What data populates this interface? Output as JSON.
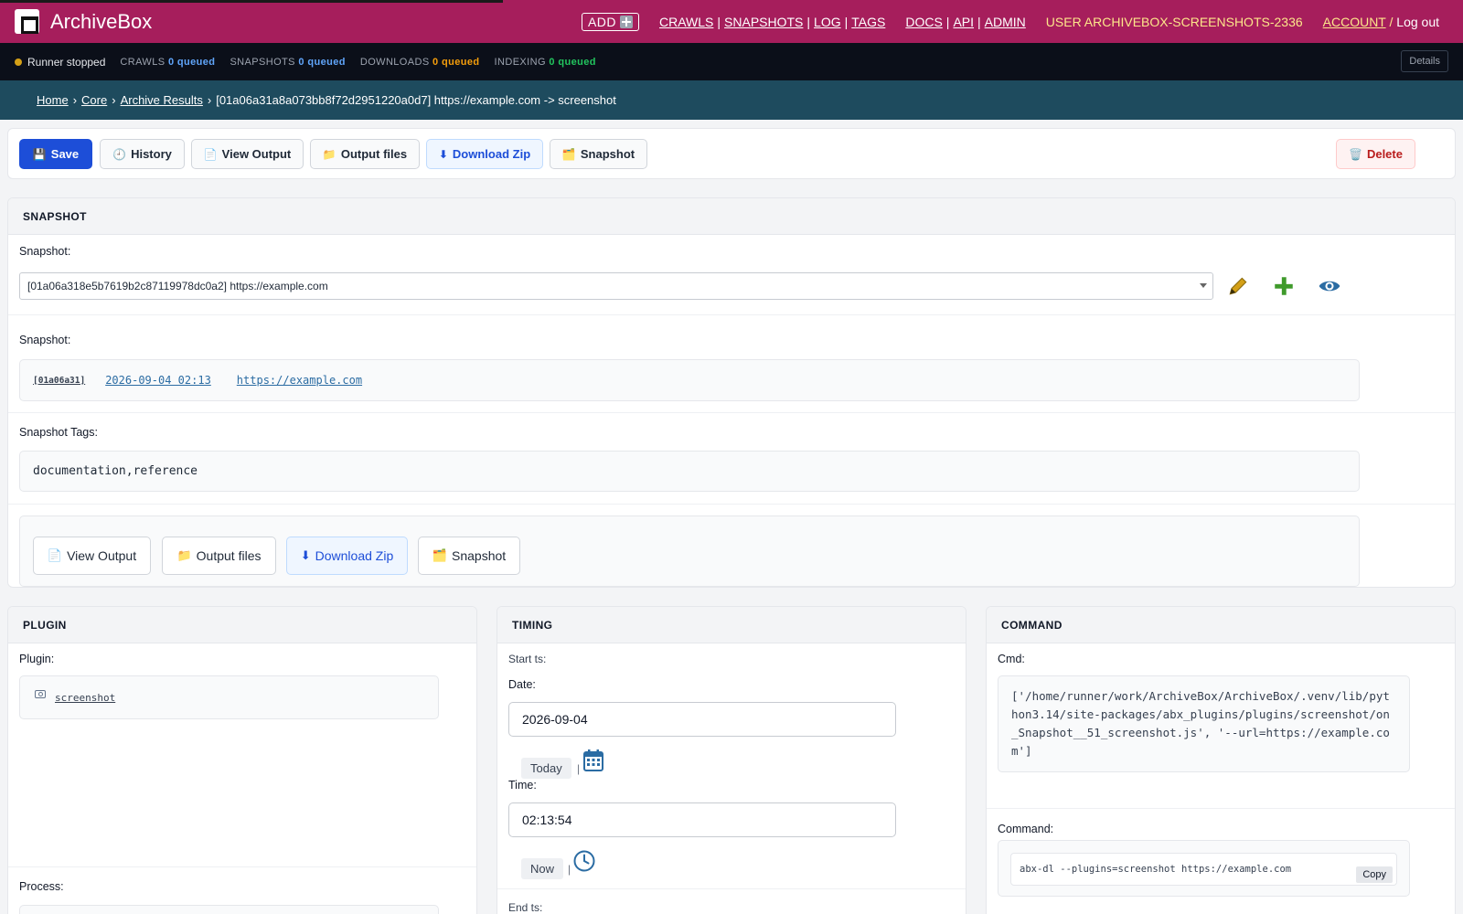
{
  "header": {
    "brand": "ArchiveBox",
    "add_label": "ADD",
    "nav_main": [
      "CRAWLS",
      "SNAPSHOTS",
      "LOG",
      "TAGS"
    ],
    "nav_docs": [
      "DOCS",
      "API",
      "ADMIN"
    ],
    "user_label": "USER ARCHIVEBOX-SCREENSHOTS-2336",
    "account": "ACCOUNT",
    "account_sep": "/",
    "logout": "Log out"
  },
  "status": {
    "runner": "Runner stopped",
    "crawls_label": "CRAWLS",
    "crawls_value": "0 queued",
    "snapshots_label": "SNAPSHOTS",
    "snapshots_value": "0 queued",
    "downloads_label": "DOWNLOADS",
    "downloads_value": "0 queued",
    "indexing_label": "INDEXING",
    "indexing_value": "0 queued",
    "details": "Details"
  },
  "breadcrumb": {
    "home": "Home",
    "core": "Core",
    "archive_results": "Archive Results",
    "current": "[01a06a31a8a073bb8f72d2951220a0d7] https://example.com -> screenshot",
    "sep": "›"
  },
  "toolbar": {
    "save": "Save",
    "history": "History",
    "view_output": "View Output",
    "output_files": "Output files",
    "download_zip": "Download Zip",
    "snapshot": "Snapshot",
    "delete": "Delete"
  },
  "snapshot_section": {
    "title": "SNAPSHOT",
    "select_label": "Snapshot:",
    "select_value": "[01a06a318e5b7619b2c87119978dc0a2] https://example.com",
    "readonly_label": "Snapshot:",
    "readonly_id": "[01a06a31]",
    "readonly_date": "2026-09-04 02:13",
    "readonly_url": "https://example.com",
    "tags_label": "Snapshot Tags:",
    "tags_value": "documentation,reference",
    "inner_view_output": "View Output",
    "inner_output_files": "Output files",
    "inner_download_zip": "Download Zip",
    "inner_snapshot": "Snapshot"
  },
  "plugin_section": {
    "title": "PLUGIN",
    "plugin_label": "Plugin:",
    "plugin_value": "screenshot",
    "process_label": "Process:"
  },
  "timing_section": {
    "title": "TIMING",
    "start_label": "Start ts:",
    "date_label": "Date:",
    "date_value": "2026-09-04",
    "today": "Today",
    "time_label": "Time:",
    "time_value": "02:13:54",
    "now": "Now",
    "sep": "|",
    "end_label": "End ts:"
  },
  "command_section": {
    "title": "COMMAND",
    "cmd_label": "Cmd:",
    "cmd_value": "['/home/runner/work/ArchiveBox/ArchiveBox/.venv/lib/python3.14/site-packages/abx_plugins/plugins/screenshot/on_Snapshot__51_screenshot.js', '--url=https://example.com']",
    "command_label": "Command:",
    "command_value": "abx-dl --plugins=screenshot https://example.com",
    "copy": "Copy"
  },
  "icons": {
    "save": "floppy-disk-icon",
    "history": "clock-icon",
    "view_output": "page-icon",
    "output_files": "folder-icon",
    "download_zip": "down-arrow-icon",
    "snapshot": "card-index-icon",
    "delete": "wastebasket-icon",
    "edit": "pencil-icon",
    "add": "plus-icon",
    "view": "eye-icon",
    "calendar": "calendar-icon",
    "clock": "clock-icon",
    "camera": "camera-icon"
  },
  "colors": {
    "header_bg": "#a61e5c",
    "status_bg": "#0b0f19",
    "breadcrumb_bg": "#1e4b5e",
    "primary": "#1d4ed8",
    "danger": "#b91c1c",
    "user_accent": "#fde68a"
  }
}
